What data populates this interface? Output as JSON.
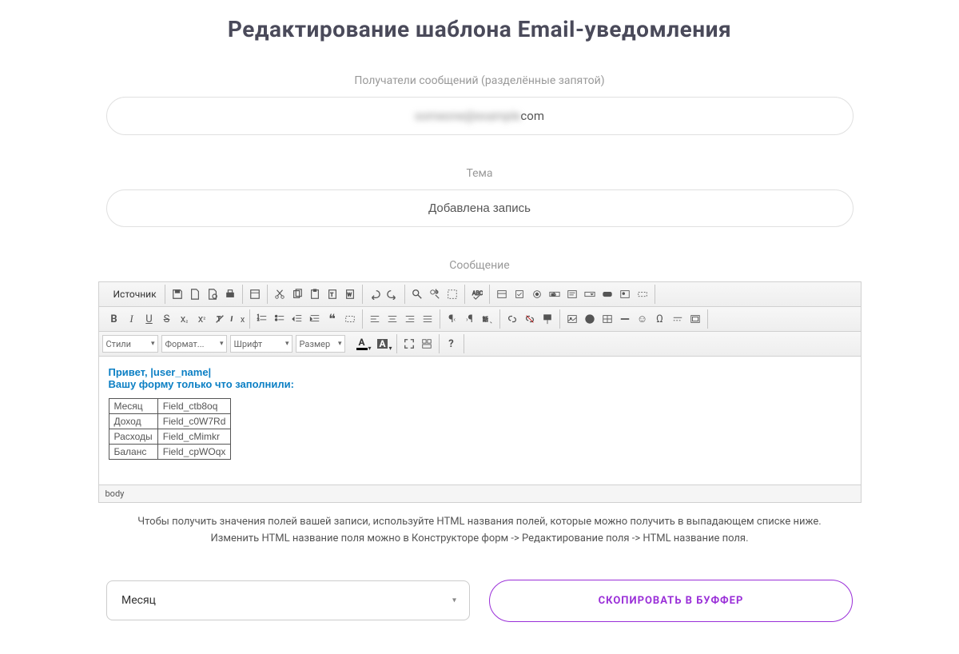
{
  "page_title": "Редактирование шаблона Email-уведомления",
  "recipients": {
    "label": "Получатели сообщений (разделённые запятой)",
    "value": "com",
    "masked_prefix": "someone@example"
  },
  "subject": {
    "label": "Тема",
    "value": "Добавлена запись"
  },
  "message": {
    "label": "Сообщение",
    "greeting": "Привет, |user_name|",
    "intro": "Вашу форму только что заполнили:",
    "table": [
      {
        "label": "Месяц",
        "field": "Field_ctb8oq"
      },
      {
        "label": "Доход",
        "field": "Field_c0W7Rd"
      },
      {
        "label": "Расходы",
        "field": "Field_cMimkr"
      },
      {
        "label": "Баланс",
        "field": "Field_cpWOqx"
      }
    ],
    "path": "body"
  },
  "toolbar": {
    "source": "Источник",
    "style": "Стили",
    "format": "Формат...",
    "font": "Шрифт",
    "size": "Размер",
    "text_color_letter": "A",
    "bg_color_letter": "A"
  },
  "help": {
    "line1": "Чтобы получить значения полей вашей записи, используйте HTML названия полей, которые можно получить в выпадающем списке ниже.",
    "line2": "Изменить HTML название поля можно в Конструкторе форм -> Редактирование поля -> HTML название поля."
  },
  "field_picker": {
    "selected": "Месяц"
  },
  "copy_button": "СКОПИРОВАТЬ В БУФФЕР"
}
